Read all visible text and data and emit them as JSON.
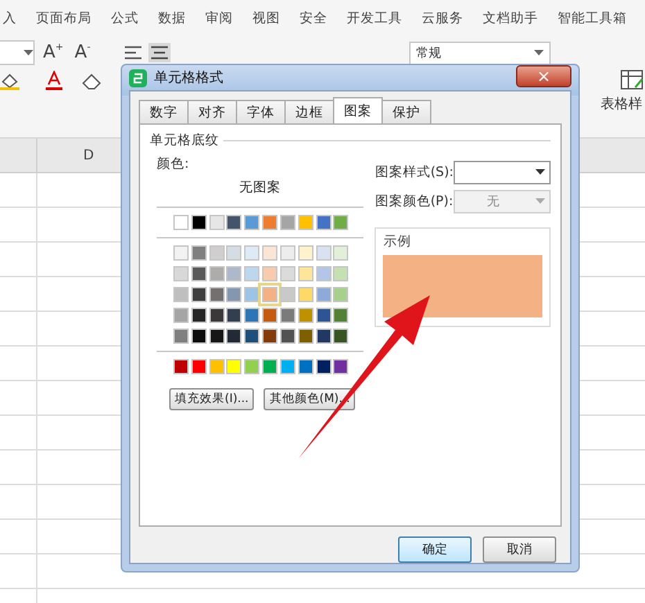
{
  "menu": [
    {
      "label": "入",
      "selected": false
    },
    {
      "label": "页面布局",
      "selected": false
    },
    {
      "label": "公式",
      "selected": false
    },
    {
      "label": "数据",
      "selected": false
    },
    {
      "label": "审阅",
      "selected": false
    },
    {
      "label": "视图",
      "selected": false
    },
    {
      "label": "安全",
      "selected": false
    },
    {
      "label": "开发工具",
      "selected": false
    },
    {
      "label": "云服务",
      "selected": false
    },
    {
      "label": "文档助手",
      "selected": false
    },
    {
      "label": "智能工具箱",
      "selected": false
    }
  ],
  "toolbar": {
    "grow_font": "A",
    "grow_sign": "+",
    "shrink_font": "A",
    "shrink_sign": "-",
    "number_format": "常规",
    "table_style": "表格样"
  },
  "sheet": {
    "column_header": "D"
  },
  "dialog": {
    "title": "单元格格式",
    "close": "×",
    "tabs": [
      {
        "label": "数字",
        "selected": false
      },
      {
        "label": "对齐",
        "selected": false
      },
      {
        "label": "字体",
        "selected": false
      },
      {
        "label": "边框",
        "selected": false
      },
      {
        "label": "图案",
        "selected": true
      },
      {
        "label": "保护",
        "selected": false
      }
    ],
    "section_title": "单元格底纹",
    "color_label": "颜色:",
    "no_pattern": "无图案",
    "theme_row": [
      {
        "color": "#ffffff",
        "selected": false
      },
      {
        "color": "#000000",
        "selected": false
      },
      {
        "color": "#e7e6e6",
        "selected": false
      },
      {
        "color": "#44546a",
        "selected": false
      },
      {
        "color": "#5b9bd5",
        "selected": false
      },
      {
        "color": "#ed7d31",
        "selected": false
      },
      {
        "color": "#a5a5a5",
        "selected": false
      },
      {
        "color": "#ffc000",
        "selected": false
      },
      {
        "color": "#4472c4",
        "selected": false
      },
      {
        "color": "#70ad47",
        "selected": false
      }
    ],
    "tint_rows": [
      [
        {
          "color": "#f2f2f2",
          "selected": false
        },
        {
          "color": "#7f7f7f",
          "selected": false
        },
        {
          "color": "#d0cece",
          "selected": false
        },
        {
          "color": "#d6dce4",
          "selected": false
        },
        {
          "color": "#deebf6",
          "selected": false
        },
        {
          "color": "#fbe5d5",
          "selected": false
        },
        {
          "color": "#ededed",
          "selected": false
        },
        {
          "color": "#fff2cc",
          "selected": false
        },
        {
          "color": "#d9e2f3",
          "selected": false
        },
        {
          "color": "#e2efd9",
          "selected": false
        }
      ],
      [
        {
          "color": "#d8d8d8",
          "selected": false
        },
        {
          "color": "#595959",
          "selected": false
        },
        {
          "color": "#aeabab",
          "selected": false
        },
        {
          "color": "#adb9ca",
          "selected": false
        },
        {
          "color": "#bdd7ee",
          "selected": false
        },
        {
          "color": "#f8cbad",
          "selected": false
        },
        {
          "color": "#dbdbdb",
          "selected": false
        },
        {
          "color": "#fee599",
          "selected": false
        },
        {
          "color": "#b4c6e7",
          "selected": false
        },
        {
          "color": "#c5e0b3",
          "selected": false
        }
      ],
      [
        {
          "color": "#bfbfbf",
          "selected": false
        },
        {
          "color": "#3f3f3f",
          "selected": false
        },
        {
          "color": "#757070",
          "selected": false
        },
        {
          "color": "#8496b0",
          "selected": false
        },
        {
          "color": "#9dc3e6",
          "selected": false
        },
        {
          "color": "#f4b183",
          "selected": true
        },
        {
          "color": "#c9c9c9",
          "selected": false
        },
        {
          "color": "#ffd965",
          "selected": false
        },
        {
          "color": "#8eaadb",
          "selected": false
        },
        {
          "color": "#a8d08d",
          "selected": false
        }
      ],
      [
        {
          "color": "#a5a5a5",
          "selected": false
        },
        {
          "color": "#262626",
          "selected": false
        },
        {
          "color": "#3a3838",
          "selected": false
        },
        {
          "color": "#323f4f",
          "selected": false
        },
        {
          "color": "#2e75b5",
          "selected": false
        },
        {
          "color": "#c55a11",
          "selected": false
        },
        {
          "color": "#7b7b7b",
          "selected": false
        },
        {
          "color": "#bf9000",
          "selected": false
        },
        {
          "color": "#2f5496",
          "selected": false
        },
        {
          "color": "#538135",
          "selected": false
        }
      ],
      [
        {
          "color": "#7f7f7f",
          "selected": false
        },
        {
          "color": "#0c0c0c",
          "selected": false
        },
        {
          "color": "#171616",
          "selected": false
        },
        {
          "color": "#222a35",
          "selected": false
        },
        {
          "color": "#1e4e79",
          "selected": false
        },
        {
          "color": "#843c0b",
          "selected": false
        },
        {
          "color": "#525252",
          "selected": false
        },
        {
          "color": "#7f6000",
          "selected": false
        },
        {
          "color": "#1f3864",
          "selected": false
        },
        {
          "color": "#375623",
          "selected": false
        }
      ]
    ],
    "standard_row": [
      {
        "color": "#c00000",
        "selected": false
      },
      {
        "color": "#ff0000",
        "selected": false
      },
      {
        "color": "#ffc000",
        "selected": false
      },
      {
        "color": "#ffff00",
        "selected": false
      },
      {
        "color": "#92d050",
        "selected": false
      },
      {
        "color": "#00b050",
        "selected": false
      },
      {
        "color": "#00b0f0",
        "selected": false
      },
      {
        "color": "#0070c0",
        "selected": false
      },
      {
        "color": "#002060",
        "selected": false
      },
      {
        "color": "#7030a0",
        "selected": false
      }
    ],
    "fill_effects": "填充效果(I)...",
    "more_colors": "其他颜色(M)...",
    "pattern_style_label": "图案样式(S):",
    "pattern_color_label": "图案颜色(P):",
    "pattern_color_value": "无",
    "pattern_color_disabled": true,
    "sample_label": "示例",
    "ok": "确定",
    "cancel": "取消"
  }
}
